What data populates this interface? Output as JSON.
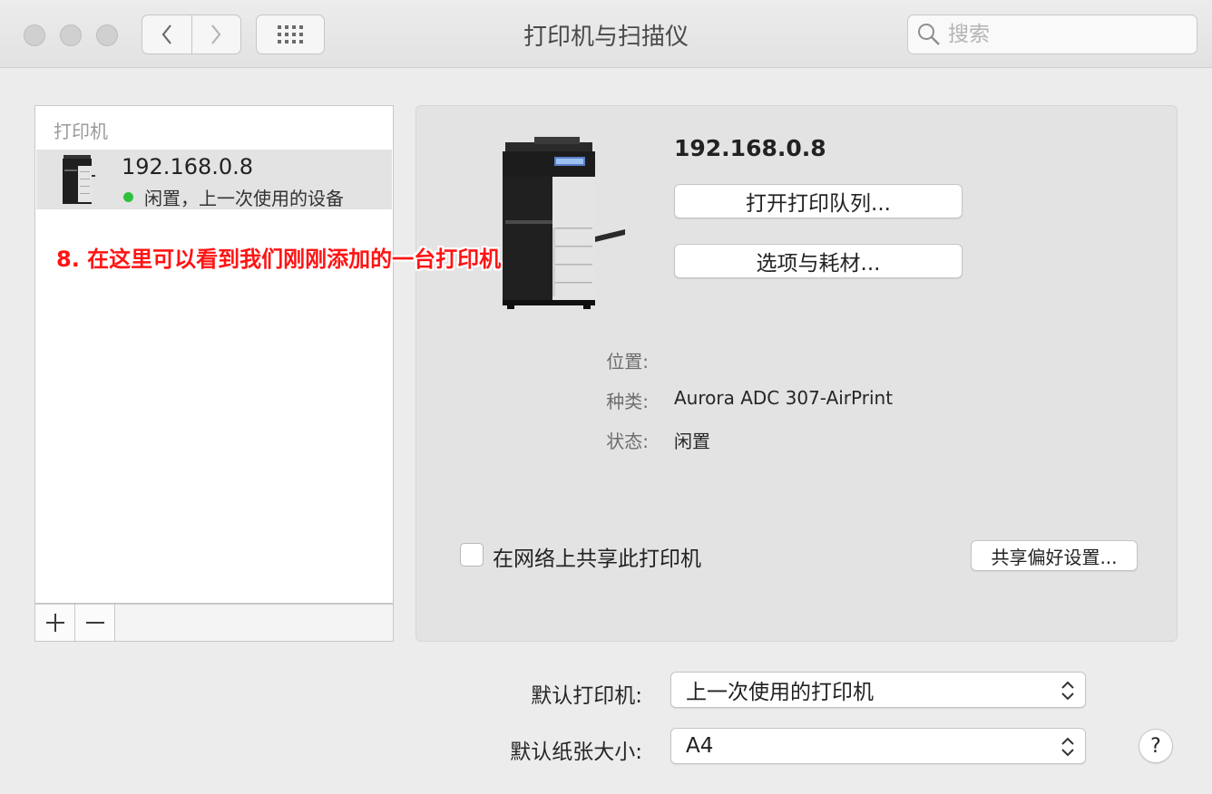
{
  "window": {
    "title": "打印机与扫描仪",
    "search_placeholder": "搜索"
  },
  "printer_list": {
    "header": "打印机",
    "items": [
      {
        "name": "192.168.0.8",
        "status": "闲置，上一次使用的设备",
        "status_color": "#2fc13e"
      }
    ],
    "add_label": "+",
    "remove_label": "−"
  },
  "annotation": "8. 在这里可以看到我们刚刚添加的一台打印机",
  "detail": {
    "printer_name": "192.168.0.8",
    "open_queue_button": "打开打印队列...",
    "options_button": "选项与耗材...",
    "location_label": "位置:",
    "location_value": "",
    "kind_label": "种类:",
    "kind_value": "Aurora ADC 307-AirPrint",
    "status_label": "状态:",
    "status_value": "闲置",
    "share_checkbox_label": "在网络上共享此打印机",
    "share_checked": false,
    "sharing_prefs_button": "共享偏好设置..."
  },
  "defaults": {
    "default_printer_label": "默认打印机:",
    "default_printer_value": "上一次使用的打印机",
    "default_paper_label": "默认纸张大小:",
    "default_paper_value": "A4"
  },
  "help_label": "?"
}
